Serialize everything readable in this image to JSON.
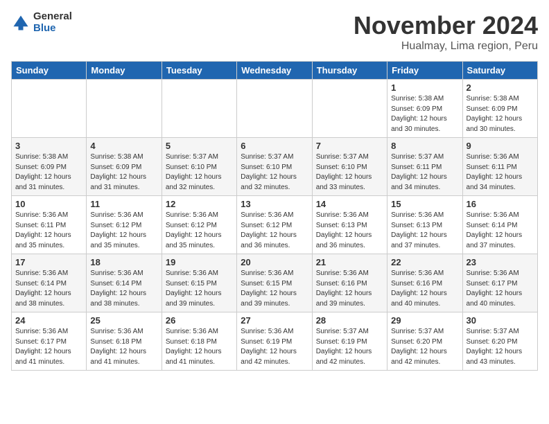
{
  "logo": {
    "general": "General",
    "blue": "Blue"
  },
  "header": {
    "title": "November 2024",
    "location": "Hualmay, Lima region, Peru"
  },
  "weekdays": [
    "Sunday",
    "Monday",
    "Tuesday",
    "Wednesday",
    "Thursday",
    "Friday",
    "Saturday"
  ],
  "weeks": [
    [
      {
        "day": "",
        "info": ""
      },
      {
        "day": "",
        "info": ""
      },
      {
        "day": "",
        "info": ""
      },
      {
        "day": "",
        "info": ""
      },
      {
        "day": "",
        "info": ""
      },
      {
        "day": "1",
        "info": "Sunrise: 5:38 AM\nSunset: 6:09 PM\nDaylight: 12 hours\nand 30 minutes."
      },
      {
        "day": "2",
        "info": "Sunrise: 5:38 AM\nSunset: 6:09 PM\nDaylight: 12 hours\nand 30 minutes."
      }
    ],
    [
      {
        "day": "3",
        "info": "Sunrise: 5:38 AM\nSunset: 6:09 PM\nDaylight: 12 hours\nand 31 minutes."
      },
      {
        "day": "4",
        "info": "Sunrise: 5:38 AM\nSunset: 6:09 PM\nDaylight: 12 hours\nand 31 minutes."
      },
      {
        "day": "5",
        "info": "Sunrise: 5:37 AM\nSunset: 6:10 PM\nDaylight: 12 hours\nand 32 minutes."
      },
      {
        "day": "6",
        "info": "Sunrise: 5:37 AM\nSunset: 6:10 PM\nDaylight: 12 hours\nand 32 minutes."
      },
      {
        "day": "7",
        "info": "Sunrise: 5:37 AM\nSunset: 6:10 PM\nDaylight: 12 hours\nand 33 minutes."
      },
      {
        "day": "8",
        "info": "Sunrise: 5:37 AM\nSunset: 6:11 PM\nDaylight: 12 hours\nand 34 minutes."
      },
      {
        "day": "9",
        "info": "Sunrise: 5:36 AM\nSunset: 6:11 PM\nDaylight: 12 hours\nand 34 minutes."
      }
    ],
    [
      {
        "day": "10",
        "info": "Sunrise: 5:36 AM\nSunset: 6:11 PM\nDaylight: 12 hours\nand 35 minutes."
      },
      {
        "day": "11",
        "info": "Sunrise: 5:36 AM\nSunset: 6:12 PM\nDaylight: 12 hours\nand 35 minutes."
      },
      {
        "day": "12",
        "info": "Sunrise: 5:36 AM\nSunset: 6:12 PM\nDaylight: 12 hours\nand 35 minutes."
      },
      {
        "day": "13",
        "info": "Sunrise: 5:36 AM\nSunset: 6:12 PM\nDaylight: 12 hours\nand 36 minutes."
      },
      {
        "day": "14",
        "info": "Sunrise: 5:36 AM\nSunset: 6:13 PM\nDaylight: 12 hours\nand 36 minutes."
      },
      {
        "day": "15",
        "info": "Sunrise: 5:36 AM\nSunset: 6:13 PM\nDaylight: 12 hours\nand 37 minutes."
      },
      {
        "day": "16",
        "info": "Sunrise: 5:36 AM\nSunset: 6:14 PM\nDaylight: 12 hours\nand 37 minutes."
      }
    ],
    [
      {
        "day": "17",
        "info": "Sunrise: 5:36 AM\nSunset: 6:14 PM\nDaylight: 12 hours\nand 38 minutes."
      },
      {
        "day": "18",
        "info": "Sunrise: 5:36 AM\nSunset: 6:14 PM\nDaylight: 12 hours\nand 38 minutes."
      },
      {
        "day": "19",
        "info": "Sunrise: 5:36 AM\nSunset: 6:15 PM\nDaylight: 12 hours\nand 39 minutes."
      },
      {
        "day": "20",
        "info": "Sunrise: 5:36 AM\nSunset: 6:15 PM\nDaylight: 12 hours\nand 39 minutes."
      },
      {
        "day": "21",
        "info": "Sunrise: 5:36 AM\nSunset: 6:16 PM\nDaylight: 12 hours\nand 39 minutes."
      },
      {
        "day": "22",
        "info": "Sunrise: 5:36 AM\nSunset: 6:16 PM\nDaylight: 12 hours\nand 40 minutes."
      },
      {
        "day": "23",
        "info": "Sunrise: 5:36 AM\nSunset: 6:17 PM\nDaylight: 12 hours\nand 40 minutes."
      }
    ],
    [
      {
        "day": "24",
        "info": "Sunrise: 5:36 AM\nSunset: 6:17 PM\nDaylight: 12 hours\nand 41 minutes."
      },
      {
        "day": "25",
        "info": "Sunrise: 5:36 AM\nSunset: 6:18 PM\nDaylight: 12 hours\nand 41 minutes."
      },
      {
        "day": "26",
        "info": "Sunrise: 5:36 AM\nSunset: 6:18 PM\nDaylight: 12 hours\nand 41 minutes."
      },
      {
        "day": "27",
        "info": "Sunrise: 5:36 AM\nSunset: 6:19 PM\nDaylight: 12 hours\nand 42 minutes."
      },
      {
        "day": "28",
        "info": "Sunrise: 5:37 AM\nSunset: 6:19 PM\nDaylight: 12 hours\nand 42 minutes."
      },
      {
        "day": "29",
        "info": "Sunrise: 5:37 AM\nSunset: 6:20 PM\nDaylight: 12 hours\nand 42 minutes."
      },
      {
        "day": "30",
        "info": "Sunrise: 5:37 AM\nSunset: 6:20 PM\nDaylight: 12 hours\nand 43 minutes."
      }
    ]
  ]
}
